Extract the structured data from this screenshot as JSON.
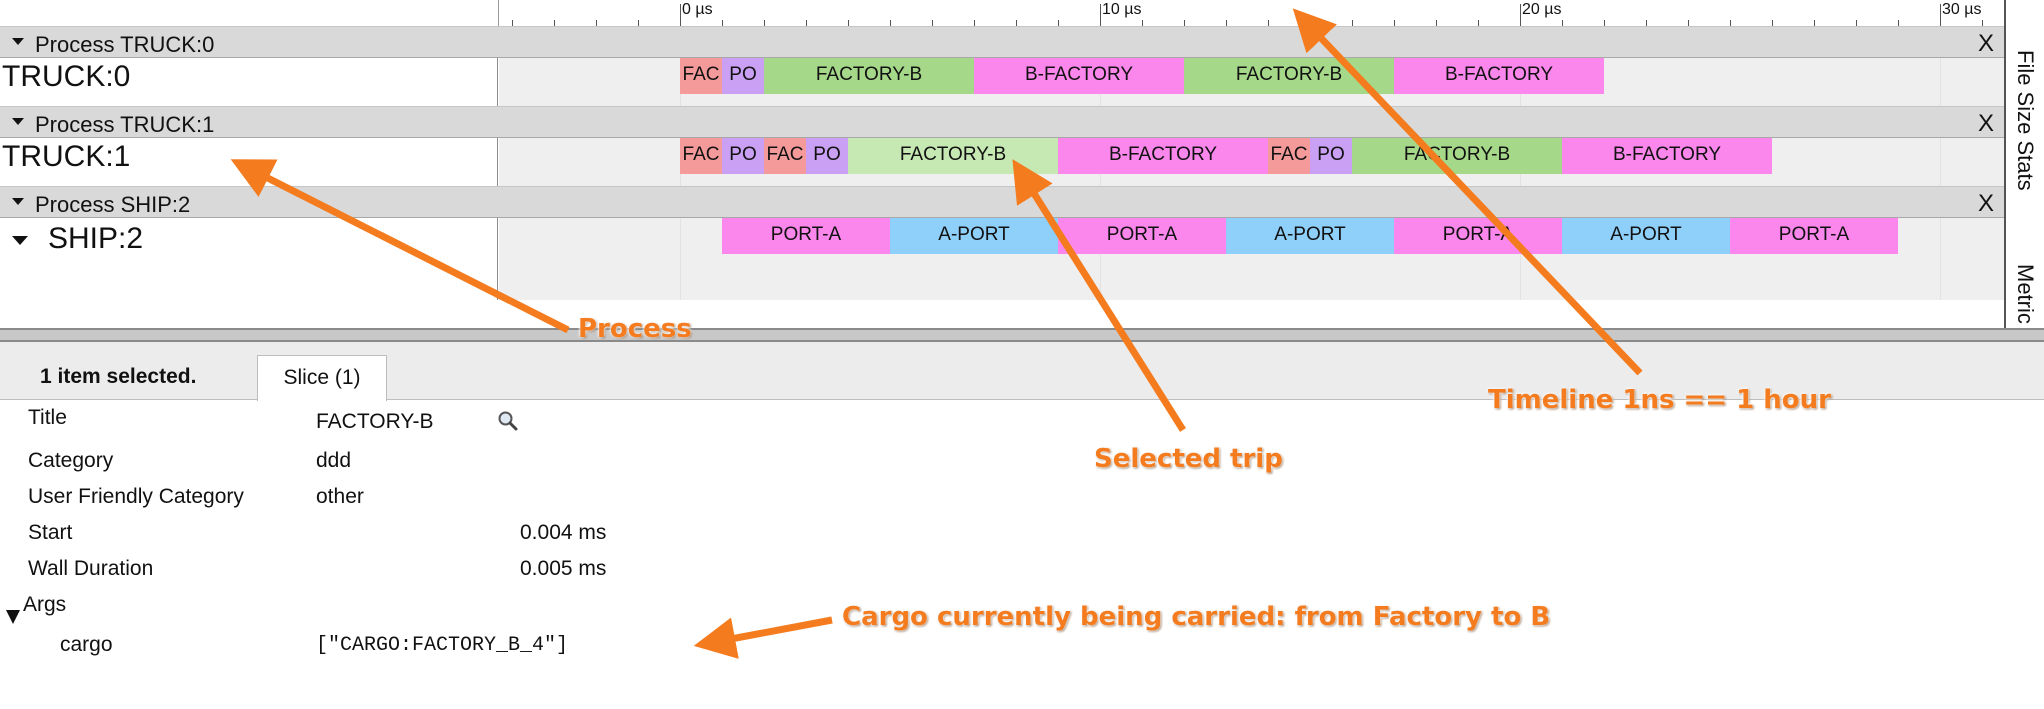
{
  "ruler": {
    "ticks": [
      {
        "label": "0 µs"
      },
      {
        "label": "10 µs"
      },
      {
        "label": "20 µs"
      },
      {
        "label": "30 µs"
      }
    ]
  },
  "processes": [
    {
      "header": "Process TRUCK:0",
      "close": "X",
      "track_label": "TRUCK:0",
      "slices": [
        {
          "label": "FAC",
          "kind": "fac"
        },
        {
          "label": "PO",
          "kind": "po"
        },
        {
          "label": "FACTORY-B",
          "kind": "fb"
        },
        {
          "label": "B-FACTORY",
          "kind": "bf"
        },
        {
          "label": "FACTORY-B",
          "kind": "fb"
        },
        {
          "label": "B-FACTORY",
          "kind": "bf"
        }
      ]
    },
    {
      "header": "Process TRUCK:1",
      "close": "X",
      "track_label": "TRUCK:1",
      "slices": [
        {
          "label": "FAC",
          "kind": "fac"
        },
        {
          "label": "PO",
          "kind": "po"
        },
        {
          "label": "FAC",
          "kind": "fac"
        },
        {
          "label": "PO",
          "kind": "po"
        },
        {
          "label": "FACTORY-B",
          "kind": "fb",
          "selected": true
        },
        {
          "label": "B-FACTORY",
          "kind": "bf"
        },
        {
          "label": "FAC",
          "kind": "fac"
        },
        {
          "label": "PO",
          "kind": "po"
        },
        {
          "label": "FACTORY-B",
          "kind": "fb"
        },
        {
          "label": "B-FACTORY",
          "kind": "bf"
        }
      ]
    },
    {
      "header": "Process SHIP:2",
      "close": "X",
      "track_label": "SHIP:2",
      "slices": [
        {
          "label": "PORT-A",
          "kind": "port"
        },
        {
          "label": "A-PORT",
          "kind": "aport"
        },
        {
          "label": "PORT-A",
          "kind": "port"
        },
        {
          "label": "A-PORT",
          "kind": "aport"
        },
        {
          "label": "PORT-A",
          "kind": "port"
        },
        {
          "label": "A-PORT",
          "kind": "aport"
        },
        {
          "label": "PORT-A",
          "kind": "port"
        }
      ]
    }
  ],
  "side_tabs": [
    "File Size Stats",
    "Metric"
  ],
  "analysis": {
    "selection_summary": "1 item selected.",
    "tab_label": "Slice (1)",
    "props": {
      "title_key": "Title",
      "title_val": "FACTORY-B",
      "category_key": "Category",
      "category_val": "ddd",
      "ufc_key": "User Friendly Category",
      "ufc_val": "other",
      "start_key": "Start",
      "start_val": "0.004 ms",
      "wall_key": "Wall Duration",
      "wall_val": "0.005 ms",
      "args_key": "Args",
      "cargo_key": "cargo",
      "cargo_val": "[\"CARGO:FACTORY_B_4\"]"
    }
  },
  "annotations": {
    "process": "Process",
    "timeline": "Timeline 1ns == 1 hour",
    "selected_trip": "Selected trip",
    "cargo": "Cargo currently being carried: from Factory to B"
  },
  "colors": {
    "fac": "#f59a9a",
    "po": "#c9a0f3",
    "fb": "#a6d889",
    "fb_selected": "#c6e8b3",
    "bf": "#fb87ec",
    "port": "#fb87ec",
    "aport": "#8fd0fb",
    "annotation": "#f47b1e"
  }
}
